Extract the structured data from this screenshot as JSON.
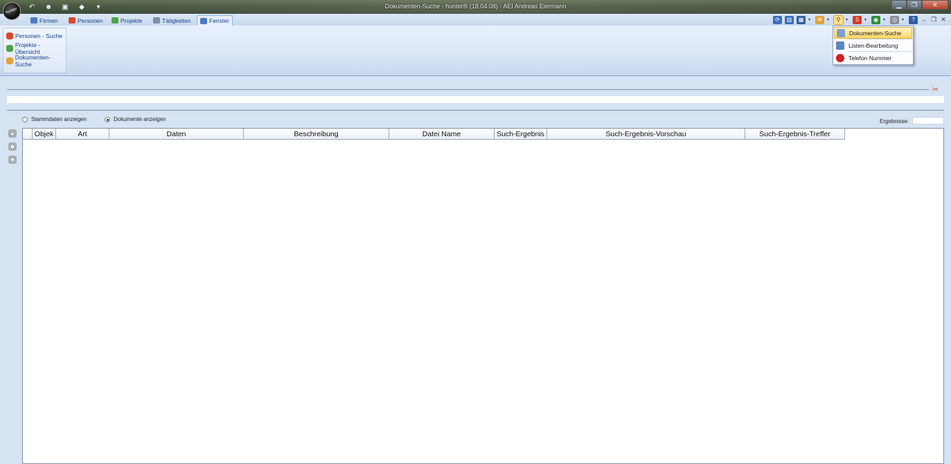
{
  "window": {
    "title": "Dokumenten-Suche - hunter® (18.04.08) - AEI Andreas Eiermann",
    "app_logo_text": "hunter",
    "controls": {
      "minimize": "▁",
      "restore": "❐",
      "close": "✕"
    }
  },
  "quick_access": [
    {
      "icon": "back-arrow-icon",
      "glyph": "↶"
    },
    {
      "icon": "person-add-icon",
      "glyph": "☻"
    },
    {
      "icon": "folder-icon",
      "glyph": "▣"
    },
    {
      "icon": "tag-icon",
      "glyph": "◆"
    },
    {
      "icon": "customize-qat-icon",
      "glyph": "▾"
    }
  ],
  "tabs": [
    {
      "label": "Firmen",
      "icon": "company-icon",
      "color": "#4a7bc0"
    },
    {
      "label": "Personen",
      "icon": "person-icon",
      "color": "#d9482f"
    },
    {
      "label": "Projekte",
      "icon": "project-icon",
      "color": "#4ea24a"
    },
    {
      "label": "Tätigkeiten",
      "icon": "task-icon",
      "color": "#7b8fa8"
    },
    {
      "label": "Fenster",
      "icon": "window-icon",
      "color": "#4a7bc0",
      "active": true
    }
  ],
  "ribbon_group": {
    "items": [
      {
        "label": "Personen - Suche",
        "icon": "person-search-icon",
        "color": "#d9482f"
      },
      {
        "label": "Projekte - Übersicht",
        "icon": "project-overview-icon",
        "color": "#4ea24a"
      },
      {
        "label": "Dokumenten-Suche",
        "icon": "document-search-icon",
        "color": "#e2a23b"
      }
    ]
  },
  "right_toolbar": [
    {
      "icon": "refresh-icon",
      "glyph": "⟳",
      "color": "#3b6fb6"
    },
    {
      "icon": "chart-icon",
      "glyph": "▥",
      "color": "#3b6fb6"
    },
    {
      "icon": "calendar-icon",
      "glyph": "▦",
      "color": "#2f5f9e"
    },
    {
      "icon": "mail-icon",
      "glyph": "✉",
      "color": "#e2a23b"
    },
    {
      "icon": "search-icon",
      "glyph": "⚲",
      "color": "#ffe08a",
      "active": true
    },
    {
      "icon": "stop-icon",
      "glyph": "S",
      "color": "#d03a2a"
    },
    {
      "icon": "globe-icon",
      "glyph": "◉",
      "color": "#2f8f3a"
    },
    {
      "icon": "clock-icon",
      "glyph": "◷",
      "color": "#8a8f96"
    },
    {
      "icon": "help-icon",
      "glyph": "?",
      "color": "#2f5f9e"
    }
  ],
  "dropdown": {
    "items": [
      {
        "label": "Dokumenten-Suche",
        "icon": "document-search-icon",
        "color": "#7ea0c8",
        "highlighted": true
      },
      {
        "label": "Listen-Bearbeitung",
        "icon": "list-edit-icon",
        "color": "#5b86c2"
      },
      {
        "label": "Telefon Nummer",
        "icon": "phone-icon",
        "color": "#d02020"
      }
    ]
  },
  "options": {
    "stammdaten": "Stammdaten anzeigen",
    "dokumente": "Dokumente anzeigen",
    "selected": "dokumente"
  },
  "results": {
    "label": "Ergebnisse:",
    "value": ""
  },
  "grid": {
    "columns": [
      {
        "label": "Objek",
        "w": 34
      },
      {
        "label": "Art",
        "w": 77
      },
      {
        "label": "Daten",
        "w": 194
      },
      {
        "label": "Beschreibung",
        "w": 210
      },
      {
        "label": "Datei Name",
        "w": 152
      },
      {
        "label": "Such-Ergebnis",
        "w": 76
      },
      {
        "label": "Such-Ergebnis-Vorschau",
        "w": 286
      },
      {
        "label": "Such-Ergebnis-Treffer",
        "w": 144
      }
    ]
  }
}
